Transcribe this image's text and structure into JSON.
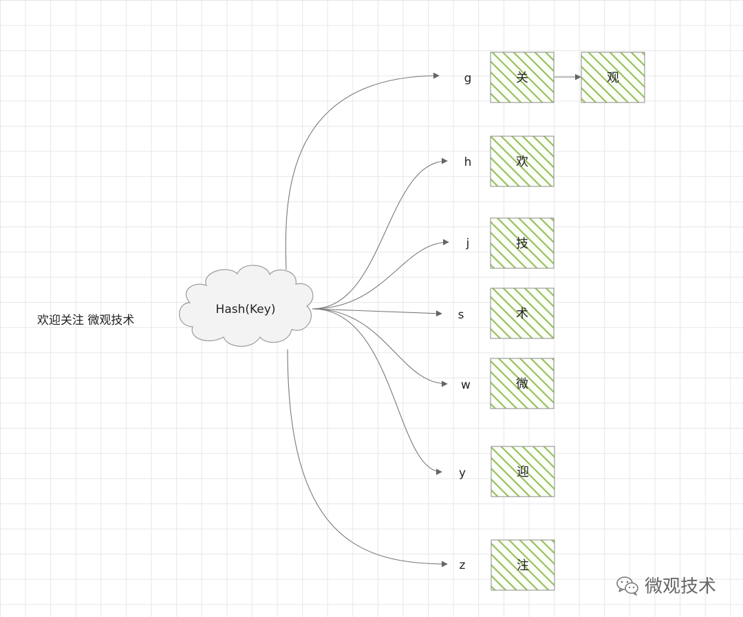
{
  "caption": "欢迎关注 微观技术",
  "hash_node": {
    "label": "Hash(Key)"
  },
  "buckets": [
    {
      "key": "g",
      "chain": [
        "关",
        "观"
      ]
    },
    {
      "key": "h",
      "chain": [
        "欢"
      ]
    },
    {
      "key": "j",
      "chain": [
        "技"
      ]
    },
    {
      "key": "s",
      "chain": [
        "术"
      ]
    },
    {
      "key": "w",
      "chain": [
        "微"
      ]
    },
    {
      "key": "y",
      "chain": [
        "迎"
      ]
    },
    {
      "key": "z",
      "chain": [
        "注"
      ]
    }
  ],
  "watermark": {
    "text": "微观技术",
    "icon": "wechat-icon"
  },
  "colors": {
    "hatch": "#97c05f",
    "box_border": "#8a8a8a",
    "box_fill": "#fbfdf7",
    "edge": "#777777",
    "grid": "#e6e6e6"
  }
}
